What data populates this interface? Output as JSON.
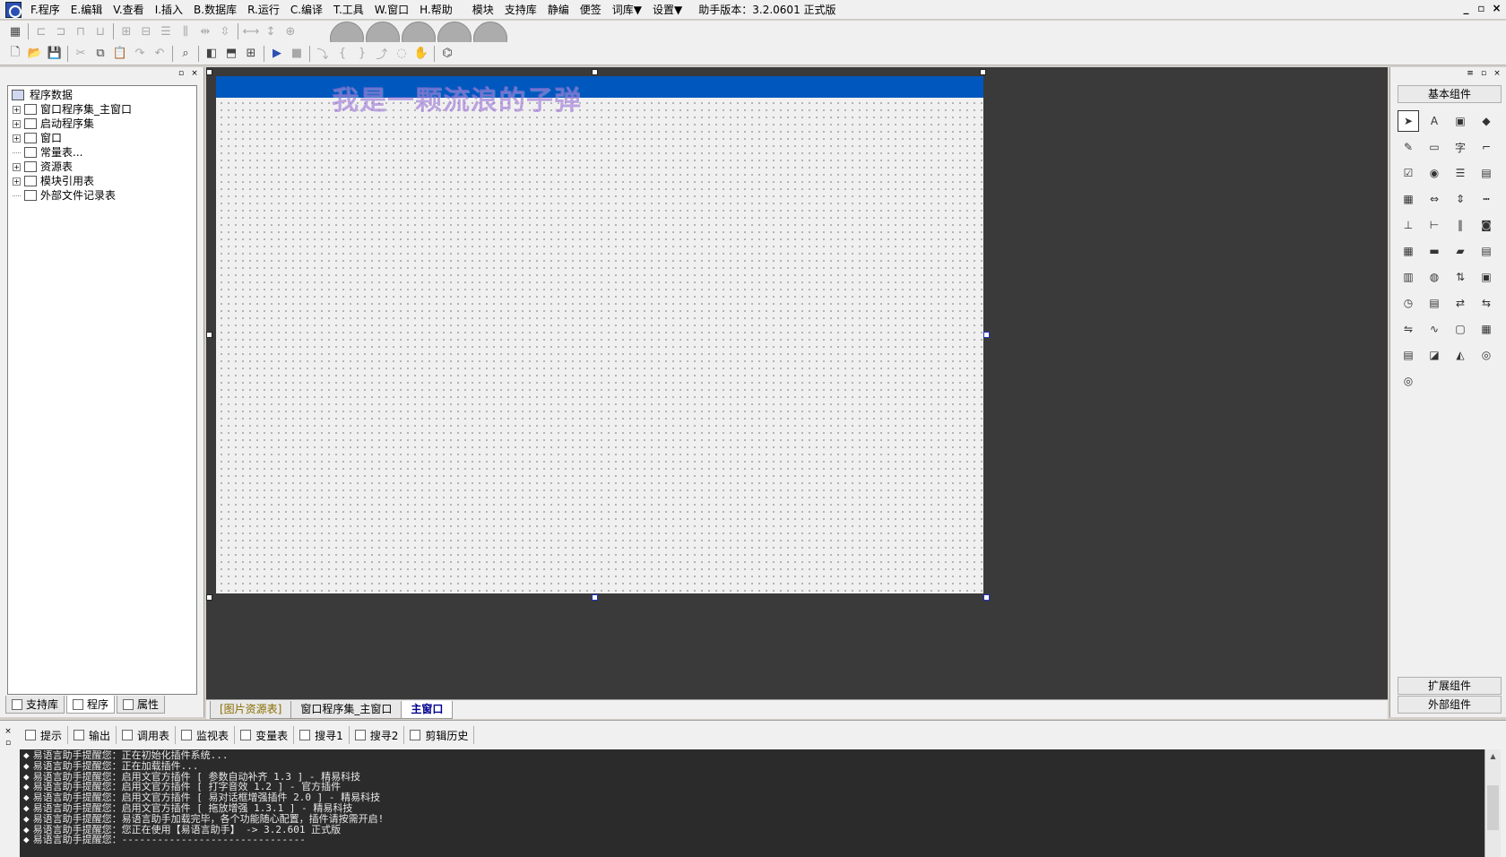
{
  "menu": {
    "items": [
      "F.程序",
      "E.编辑",
      "V.查看",
      "I.插入",
      "B.数据库",
      "R.运行",
      "C.编译",
      "T.工具",
      "W.窗口",
      "H.帮助",
      "模块",
      "支持库",
      "静编",
      "便签",
      "词库▼",
      "设置▼"
    ],
    "version": "助手版本：3.2.0601 正式版",
    "window_controls": [
      "_",
      "▫",
      "×"
    ]
  },
  "left_panel": {
    "tree": {
      "root": "程序数据",
      "nodes": [
        {
          "label": "窗口程序集_主窗口",
          "icon": "layers-icon",
          "expand": "+"
        },
        {
          "label": "启动程序集",
          "icon": "layers-icon",
          "expand": "+"
        },
        {
          "label": "窗口",
          "icon": "window-icon",
          "expand": "+"
        },
        {
          "label": "常量表...",
          "icon": "constant-icon",
          "expand": ""
        },
        {
          "label": "资源表",
          "icon": "resource-icon",
          "expand": "+"
        },
        {
          "label": "模块引用表",
          "icon": "module-icon",
          "expand": "+"
        },
        {
          "label": "外部文件记录表",
          "icon": "file-icon",
          "expand": ""
        }
      ]
    },
    "tabs": [
      "支持库",
      "程序",
      "属性"
    ]
  },
  "designer": {
    "overlay_text": "我是一颗流浪的子弹"
  },
  "center_tabs": [
    "[图片资源表]",
    "窗口程序集_主窗口",
    "主窗口"
  ],
  "right_panel": {
    "basic_group": "基本组件",
    "ext_group": "扩展组件",
    "external_group": "外部组件",
    "palette": [
      {
        "name": "pointer-tool",
        "glyph": "➤"
      },
      {
        "name": "label-tool",
        "glyph": "A"
      },
      {
        "name": "picture-tool",
        "glyph": "▣"
      },
      {
        "name": "shape-tool",
        "glyph": "◆"
      },
      {
        "name": "editbox-tool",
        "glyph": "✎"
      },
      {
        "name": "groupbox-tool",
        "glyph": "▭"
      },
      {
        "name": "text-tool",
        "glyph": "字"
      },
      {
        "name": "line-tool",
        "glyph": "⌐"
      },
      {
        "name": "checkbox-tool",
        "glyph": "☑"
      },
      {
        "name": "radio-tool",
        "glyph": "◉"
      },
      {
        "name": "listbox-tool",
        "glyph": "☰"
      },
      {
        "name": "combobox-tool",
        "glyph": "▤"
      },
      {
        "name": "grid-tool",
        "glyph": "▦"
      },
      {
        "name": "scrollbar-tool",
        "glyph": "⇔"
      },
      {
        "name": "vscroll-tool",
        "glyph": "⇕"
      },
      {
        "name": "ruler-tool",
        "glyph": "┅"
      },
      {
        "name": "hline-tool",
        "glyph": "⊥"
      },
      {
        "name": "vline-tool",
        "glyph": "⊢"
      },
      {
        "name": "slider-tool",
        "glyph": "‖"
      },
      {
        "name": "webcam-tool",
        "glyph": "◙"
      },
      {
        "name": "calendar-tool",
        "glyph": "▦"
      },
      {
        "name": "button-tool",
        "glyph": "▬"
      },
      {
        "name": "folder-tool",
        "glyph": "▰"
      },
      {
        "name": "doc-tool",
        "glyph": "▤"
      },
      {
        "name": "table-tool",
        "glyph": "▥"
      },
      {
        "name": "db-tool",
        "glyph": "◍"
      },
      {
        "name": "spin-tool",
        "glyph": "⇅"
      },
      {
        "name": "tab-tool",
        "glyph": "▣"
      },
      {
        "name": "timer-tool",
        "glyph": "◷"
      },
      {
        "name": "printer-tool",
        "glyph": "▤"
      },
      {
        "name": "net-tool",
        "glyph": "⇄"
      },
      {
        "name": "net2-tool",
        "glyph": "⇆"
      },
      {
        "name": "connect-tool",
        "glyph": "⇋"
      },
      {
        "name": "serial-tool",
        "glyph": "∿"
      },
      {
        "name": "frame-tool",
        "glyph": "▢"
      },
      {
        "name": "multi-tool",
        "glyph": "▦"
      },
      {
        "name": "datasrc-tool",
        "glyph": "▤"
      },
      {
        "name": "dbprovider-tool",
        "glyph": "◪"
      },
      {
        "name": "chart-tool",
        "glyph": "◭"
      },
      {
        "name": "odbc-tool",
        "glyph": "◎"
      },
      {
        "name": "odbc2-tool",
        "glyph": "◎"
      }
    ]
  },
  "bottom": {
    "tabs": [
      "提示",
      "输出",
      "调用表",
      "监视表",
      "变量表",
      "搜寻1",
      "搜寻2",
      "剪辑历史"
    ],
    "log_lines": [
      "易语言助手提醒您：正在初始化插件系统...",
      "易语言助手提醒您：正在加载插件...",
      "易语言助手提醒您：启用文官方插件 [ 参数自动补齐 1.3 ] - 精易科技",
      "易语言助手提醒您：启用文官方插件 [ 打字音效 1.2 ] - 官方插件",
      "易语言助手提醒您：启用文官方插件 [ 易对话框增强插件 2.0 ] - 精易科技",
      "易语言助手提醒您：启用文官方插件 [ 拖放增强 1.3.1 ] - 精易科技",
      "易语言助手提醒您：易语言助手加载完毕，各个功能随心配置，插件请按需开启!",
      "易语言助手提醒您：您正在使用【易语言助手】 -> 3.2.601 正式版",
      "易语言助手提醒您：-------------------------------"
    ]
  }
}
